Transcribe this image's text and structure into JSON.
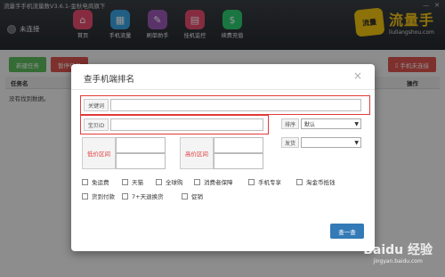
{
  "window": {
    "title": "流量手手机流量数V3.6.1-金秋电商旗下"
  },
  "status": {
    "connection": "未连接"
  },
  "nav": [
    {
      "label": "首页",
      "icon": "home-icon",
      "glyph": "⌂",
      "color": "#e84c6f"
    },
    {
      "label": "手机流量",
      "icon": "traffic-icon",
      "glyph": "▦",
      "color": "#3aa3e3"
    },
    {
      "label": "刷单助手",
      "icon": "edit-icon",
      "glyph": "✎",
      "color": "#9b59b6"
    },
    {
      "label": "挂机监控",
      "icon": "film-icon",
      "glyph": "▤",
      "color": "#e84c6f"
    },
    {
      "label": "续费充值",
      "icon": "dollar-icon",
      "glyph": "$",
      "color": "#2ecc71"
    }
  ],
  "logo": {
    "title": "流量手",
    "sub": "liuliangshou.com",
    "seal": "流量"
  },
  "toolbar": {
    "new_task": "新建任务",
    "second": "暂停任务",
    "phone_unconnected": "手机未连接"
  },
  "table": {
    "col_task": "任务名",
    "col_op": "操作",
    "empty": "没有找到数据。"
  },
  "modal": {
    "title": "查手机端排名",
    "close": "×",
    "keyword_label": "关键词",
    "keyword_value": "",
    "baobei_label": "宝贝ID",
    "baobei_value": "",
    "sort_label": "排序",
    "sort_value": "默认",
    "ship_label": "发货",
    "ship_value": "",
    "low_price_label": "低价区间",
    "high_price_label": "高价区间",
    "checkboxes_row1": [
      "免运费",
      "天猫",
      "全球购",
      "消费者保障",
      "手机专享",
      "淘金币抵钱"
    ],
    "checkboxes_row2": [
      "货到付款",
      "7+天退换货",
      "促销"
    ],
    "search_button": "查一查"
  },
  "watermark": {
    "main": "Baidu 经验",
    "sub": "jingyan.baidu.com"
  },
  "colors": {
    "highlight": "#e23a3a",
    "primary": "#337ab7",
    "green": "#5cb85c"
  }
}
